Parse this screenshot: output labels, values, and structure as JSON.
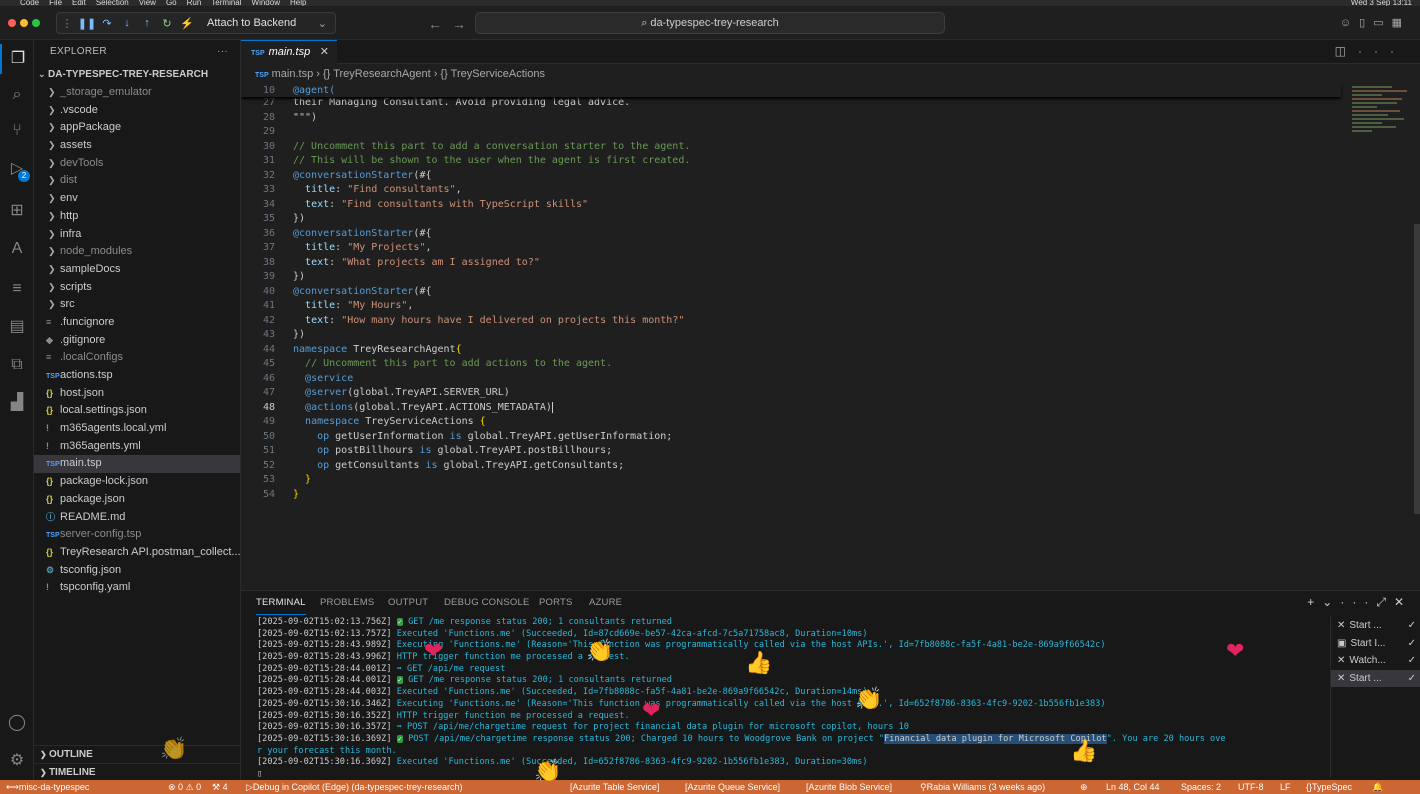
{
  "menubar": {
    "items": [
      "Code",
      "File",
      "Edit",
      "Selection",
      "View",
      "Go",
      "Run",
      "Terminal",
      "Window",
      "Help"
    ],
    "clock": "Wed 3 Sep 13:11"
  },
  "debug_toolbar": {
    "config_label": "Attach to Backend"
  },
  "command_center": {
    "label": "da-typespec-trey-research"
  },
  "activity_bar": {
    "run_debug_badge": "2"
  },
  "explorer": {
    "title": "EXPLORER",
    "root": "DA-TYPESPEC-TREY-RESEARCH",
    "items": [
      {
        "name": "_storage_emulator",
        "kind": "folder",
        "dim": true
      },
      {
        "name": ".vscode",
        "kind": "folder"
      },
      {
        "name": "appPackage",
        "kind": "folder"
      },
      {
        "name": "assets",
        "kind": "folder"
      },
      {
        "name": "devTools",
        "kind": "folder",
        "dim": true
      },
      {
        "name": "dist",
        "kind": "folder",
        "dim": true
      },
      {
        "name": "env",
        "kind": "folder"
      },
      {
        "name": "http",
        "kind": "folder"
      },
      {
        "name": "infra",
        "kind": "folder"
      },
      {
        "name": "node_modules",
        "kind": "folder",
        "dim": true
      },
      {
        "name": "sampleDocs",
        "kind": "folder"
      },
      {
        "name": "scripts",
        "kind": "folder"
      },
      {
        "name": "src",
        "kind": "folder"
      },
      {
        "name": ".funcignore",
        "kind": "list"
      },
      {
        "name": ".gitignore",
        "kind": "gear"
      },
      {
        "name": ".localConfigs",
        "kind": "list",
        "dim": true
      },
      {
        "name": "actions.tsp",
        "kind": "tsp"
      },
      {
        "name": "host.json",
        "kind": "json"
      },
      {
        "name": "local.settings.json",
        "kind": "json"
      },
      {
        "name": "m365agents.local.yml",
        "kind": "yml"
      },
      {
        "name": "m365agents.yml",
        "kind": "yml"
      },
      {
        "name": "main.tsp",
        "kind": "tsp",
        "selected": true
      },
      {
        "name": "package-lock.json",
        "kind": "json"
      },
      {
        "name": "package.json",
        "kind": "json"
      },
      {
        "name": "README.md",
        "kind": "md"
      },
      {
        "name": "server-config.tsp",
        "kind": "tsp",
        "dim": true
      },
      {
        "name": "TreyResearch API.postman_collect...",
        "kind": "json"
      },
      {
        "name": "tsconfig.json",
        "kind": "ts"
      },
      {
        "name": "tspconfig.yaml",
        "kind": "yml"
      }
    ],
    "outline_label": "OUTLINE",
    "timeline_label": "TIMELINE"
  },
  "editor": {
    "tab": "main.tsp",
    "breadcrumb": [
      "main.tsp",
      "{} TreyResearchAgent",
      "{} TreyServiceActions"
    ],
    "sticky_line": {
      "num": "10",
      "text": "@agent("
    },
    "lines": [
      {
        "num": "27",
        "tokens": [
          [
            "plain",
            "their Managing Consultant. Avoid providing legal advice."
          ]
        ]
      },
      {
        "num": "28",
        "tokens": [
          [
            "plain",
            "\"\"\")"
          ]
        ]
      },
      {
        "num": "29",
        "tokens": []
      },
      {
        "num": "30",
        "tokens": [
          [
            "comment",
            "// Uncomment this part to add a conversation starter to the agent."
          ]
        ]
      },
      {
        "num": "31",
        "tokens": [
          [
            "comment",
            "// This will be shown to the user when the agent is first created."
          ]
        ]
      },
      {
        "num": "32",
        "tokens": [
          [
            "dec",
            "@conversationStarter"
          ],
          [
            "plain",
            "(#{"
          ]
        ]
      },
      {
        "num": "33",
        "tokens": [
          [
            "plain",
            "  "
          ],
          [
            "key",
            "title"
          ],
          [
            "plain",
            ": "
          ],
          [
            "str",
            "\"Find consultants\""
          ],
          [
            "plain",
            ","
          ]
        ]
      },
      {
        "num": "34",
        "tokens": [
          [
            "plain",
            "  "
          ],
          [
            "key",
            "text"
          ],
          [
            "plain",
            ": "
          ],
          [
            "str",
            "\"Find consultants with TypeScript skills\""
          ]
        ]
      },
      {
        "num": "35",
        "tokens": [
          [
            "plain",
            "})"
          ]
        ]
      },
      {
        "num": "36",
        "tokens": [
          [
            "dec",
            "@conversationStarter"
          ],
          [
            "plain",
            "(#{"
          ]
        ]
      },
      {
        "num": "37",
        "tokens": [
          [
            "plain",
            "  "
          ],
          [
            "key",
            "title"
          ],
          [
            "plain",
            ": "
          ],
          [
            "str",
            "\"My Projects\""
          ],
          [
            "plain",
            ","
          ]
        ]
      },
      {
        "num": "38",
        "tokens": [
          [
            "plain",
            "  "
          ],
          [
            "key",
            "text"
          ],
          [
            "plain",
            ": "
          ],
          [
            "str",
            "\"What projects am I assigned to?\""
          ]
        ]
      },
      {
        "num": "39",
        "tokens": [
          [
            "plain",
            "})"
          ]
        ]
      },
      {
        "num": "40",
        "tokens": [
          [
            "dec",
            "@conversationStarter"
          ],
          [
            "plain",
            "(#{"
          ]
        ]
      },
      {
        "num": "41",
        "tokens": [
          [
            "plain",
            "  "
          ],
          [
            "key",
            "title"
          ],
          [
            "plain",
            ": "
          ],
          [
            "str",
            "\"My Hours\""
          ],
          [
            "plain",
            ","
          ]
        ]
      },
      {
        "num": "42",
        "tokens": [
          [
            "plain",
            "  "
          ],
          [
            "key",
            "text"
          ],
          [
            "plain",
            ": "
          ],
          [
            "str",
            "\"How many hours have I delivered on projects this month?\""
          ]
        ]
      },
      {
        "num": "43",
        "tokens": [
          [
            "plain",
            "})"
          ]
        ]
      },
      {
        "num": "44",
        "tokens": [
          [
            "kw",
            "namespace"
          ],
          [
            "plain",
            " TreyResearchAgent"
          ],
          [
            "br",
            "{"
          ]
        ]
      },
      {
        "num": "45",
        "tokens": [
          [
            "plain",
            "  "
          ],
          [
            "comment",
            "// Uncomment this part to add actions to the agent."
          ]
        ]
      },
      {
        "num": "46",
        "tokens": [
          [
            "plain",
            "  "
          ],
          [
            "dec",
            "@service"
          ]
        ]
      },
      {
        "num": "47",
        "tokens": [
          [
            "plain",
            "  "
          ],
          [
            "dec",
            "@server"
          ],
          [
            "plain",
            "(global.TreyAPI.SERVER_URL)"
          ]
        ]
      },
      {
        "num": "48",
        "current": true,
        "tokens": [
          [
            "plain",
            "  "
          ],
          [
            "dec",
            "@actions"
          ],
          [
            "plain",
            "(global.TreyAPI.ACTIONS_METADATA)"
          ]
        ]
      },
      {
        "num": "49",
        "tokens": [
          [
            "plain",
            "  "
          ],
          [
            "kw",
            "namespace"
          ],
          [
            "plain",
            " TreyServiceActions "
          ],
          [
            "br",
            "{"
          ]
        ]
      },
      {
        "num": "50",
        "tokens": [
          [
            "plain",
            "    "
          ],
          [
            "kw",
            "op"
          ],
          [
            "plain",
            " getUserInformation "
          ],
          [
            "kw",
            "is"
          ],
          [
            "plain",
            " global.TreyAPI.getUserInformation;"
          ]
        ]
      },
      {
        "num": "51",
        "tokens": [
          [
            "plain",
            "    "
          ],
          [
            "kw",
            "op"
          ],
          [
            "plain",
            " postBillhours "
          ],
          [
            "kw",
            "is"
          ],
          [
            "plain",
            " global.TreyAPI.postBillhours;"
          ]
        ]
      },
      {
        "num": "52",
        "tokens": [
          [
            "plain",
            "    "
          ],
          [
            "kw",
            "op"
          ],
          [
            "plain",
            " getConsultants "
          ],
          [
            "kw",
            "is"
          ],
          [
            "plain",
            " global.TreyAPI.getConsultants;"
          ]
        ]
      },
      {
        "num": "53",
        "tokens": [
          [
            "plain",
            "  "
          ],
          [
            "br",
            "}"
          ]
        ]
      },
      {
        "num": "54",
        "tokens": [
          [
            "br",
            "}"
          ]
        ]
      }
    ]
  },
  "panel": {
    "tabs": [
      "TERMINAL",
      "PROBLEMS",
      "OUTPUT",
      "DEBUG CONSOLE",
      "PORTS",
      "AZURE"
    ],
    "terminal_lines": [
      [
        [
          "ts",
          "[2025-09-02T15:02:13.756Z] "
        ],
        [
          "ok",
          "✓"
        ],
        [
          "cyan",
          " GET /me response status 200; 1 consultants returned"
        ]
      ],
      [
        [
          "ts",
          "[2025-09-02T15:02:13.757Z] "
        ],
        [
          "cyan",
          "Executed 'Functions.me' (Succeeded, Id=87cd669e-be57-42ca-afcd-7c5a71758ac8, Duration=10ms)"
        ]
      ],
      [
        [
          "ts",
          "[2025-09-02T15:28:43.989Z] "
        ],
        [
          "cyan",
          "Executing 'Functions.me' (Reason='This function was programmatically called via the host APIs.', Id=7fb8088c-fa5f-4a81-be2e-869a9f66542c)"
        ]
      ],
      [
        [
          "ts",
          "[2025-09-02T15:28:43.996Z] "
        ],
        [
          "cyan",
          "HTTP trigger function me processed a request."
        ]
      ],
      [
        [
          "ts",
          "[2025-09-02T15:28:44.001Z] "
        ],
        [
          "cyan",
          "➡ GET /api/me request"
        ]
      ],
      [
        [
          "ts",
          "[2025-09-02T15:28:44.001Z] "
        ],
        [
          "ok",
          "✓"
        ],
        [
          "cyan",
          " GET /me response status 200; 1 consultants returned"
        ]
      ],
      [
        [
          "ts",
          "[2025-09-02T15:28:44.003Z] "
        ],
        [
          "cyan",
          "Executed 'Functions.me' (Succeeded, Id=7fb8088c-fa5f-4a81-be2e-869a9f66542c, Duration=14ms)"
        ]
      ],
      [
        [
          "ts",
          "[2025-09-02T15:30:16.346Z] "
        ],
        [
          "cyan",
          "Executing 'Functions.me' (Reason='This function was programmatically called via the host APIs.', Id=652f8786-8363-4fc9-9202-1b556fb1e383)"
        ]
      ],
      [
        [
          "ts",
          "[2025-09-02T15:30:16.352Z] "
        ],
        [
          "cyan",
          "HTTP trigger function me processed a request."
        ]
      ],
      [
        [
          "ts",
          "[2025-09-02T15:30:16.357Z] "
        ],
        [
          "cyan",
          "➡ POST /api/me/chargetime request for project financial data plugin for microsoft copilot, hours 10"
        ]
      ],
      [
        [
          "ts",
          "[2025-09-02T15:30:16.369Z] "
        ],
        [
          "ok",
          "✓"
        ],
        [
          "cyan",
          " POST /api/me/chargetime response status 200; Charged 10 hours to Woodgrove Bank on project \""
        ],
        [
          "hl",
          "Financial data plugin for Microsoft Copilot"
        ],
        [
          "cyan",
          "\". You are 20 hours ove"
        ]
      ],
      [
        [
          "cyan",
          "r your forecast this month."
        ]
      ],
      [
        [
          "ts",
          "[2025-09-02T15:30:16.369Z] "
        ],
        [
          "cyan",
          "Executed 'Functions.me' (Succeeded, Id=652f8786-8363-4fc9-9202-1b556fb1e383, Duration=30ms)"
        ]
      ],
      [
        [
          "plain",
          "▯"
        ]
      ]
    ],
    "terminal_list": [
      {
        "label": "Start ...",
        "icon": "✕"
      },
      {
        "label": "Start I...",
        "icon": "▣"
      },
      {
        "label": "Watch...",
        "icon": "✕"
      },
      {
        "label": "Start ...",
        "icon": "✕",
        "selected": true
      }
    ]
  },
  "statusbar": {
    "remote": "misc-da-typespec",
    "problems": "⊗ 0 ⚠ 0",
    "ports": "⚒ 4",
    "debug": "Debug in Copilot (Edge) (da-typespec-trey-research)",
    "azurite_table": "[Azurite Table Service]",
    "azurite_queue": "[Azurite Queue Service]",
    "azurite_blob": "[Azurite Blob Service]",
    "blame": "Rabia Williams (3 weeks ago)",
    "position": "Ln 48, Col 44",
    "spaces": "Spaces: 2",
    "encoding": "UTF-8",
    "eol": "LF",
    "language": "TypeSpec"
  },
  "colors": {
    "accent": "#0078d4",
    "statusbar": "#cc6633",
    "editor_bg": "#1f1f1f"
  }
}
